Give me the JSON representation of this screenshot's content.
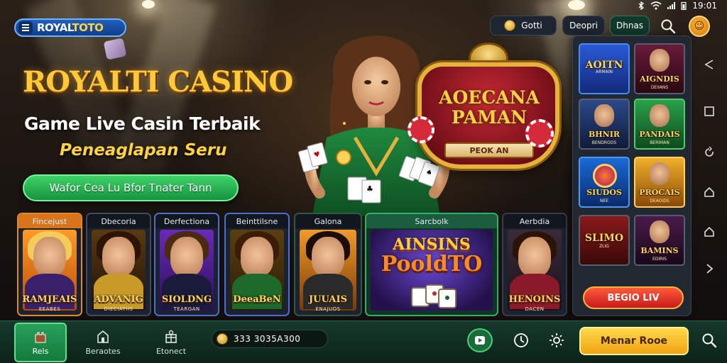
{
  "brand": {
    "logo_text_a": "ROYAL",
    "logo_text_b": "TOTO"
  },
  "status_bar": {
    "time": "19:01"
  },
  "top_bar": {
    "pill_1": "Gotti",
    "pill_2": "Deopri",
    "pill_3": "Dhnas"
  },
  "hero": {
    "title": "ROYALTI CASINO",
    "subtitle": "Game Live Casin Terbaik",
    "subtitle_2": "Peneaglapan Seru",
    "cta": "Wafor Cea Lu Bfor Tnater Tann"
  },
  "badge": {
    "title_l1": "AOECANA",
    "title_l2": "PAMAN",
    "ribbon": "PEOK AN"
  },
  "games": [
    {
      "category": "Fincejust",
      "name": "RAMJEAIS",
      "tag": "EEABES"
    },
    {
      "category": "Dbecoria",
      "name": "ADVANIG",
      "tag": "DIECIATIIS"
    },
    {
      "category": "Derfectiona",
      "name": "SIOLDNG",
      "tag": "TEARGAN"
    },
    {
      "category": "Beinttilsne",
      "name": "DeeaBeN",
      "tag": ""
    },
    {
      "category": "Galona",
      "name": "JUUAIS",
      "tag": "ENAJUOS"
    },
    {
      "category": "Sarcbolk",
      "name_l1": "AINSINS",
      "name_l2": "PooldTO"
    },
    {
      "category": "Aerbdia",
      "name": "HENOINS",
      "tag": "DACEN"
    }
  ],
  "panel": {
    "tiles": [
      {
        "name": "AOITN",
        "sub": "ARMAIN"
      },
      {
        "name": "AIGNDIS",
        "sub": "DEIIANS"
      },
      {
        "name": "BHNIR",
        "sub": "BENDROOS"
      },
      {
        "name": "PANDAIS",
        "sub": "BERIMAN"
      },
      {
        "name": "SIUDOS",
        "sub": "NEE"
      },
      {
        "name": "PROCAIS",
        "sub": "DEAOIDS"
      },
      {
        "name": "SLIMO",
        "sub": "ZLIG"
      },
      {
        "name": "BAMINS",
        "sub": "EDIRIS"
      }
    ],
    "button": "BEGIO LIV"
  },
  "bottom_bar": {
    "nav_1": "Rels",
    "nav_2": "Beraotes",
    "nav_3": "Etonect",
    "balance": "333 3035A300",
    "cta": "Menar Rooe"
  },
  "colors": {
    "accent_gold": "#ffc93a",
    "cta_green": "#16933c",
    "cta_yellow": "#f0a412",
    "panel_button": "#c71c1c"
  }
}
